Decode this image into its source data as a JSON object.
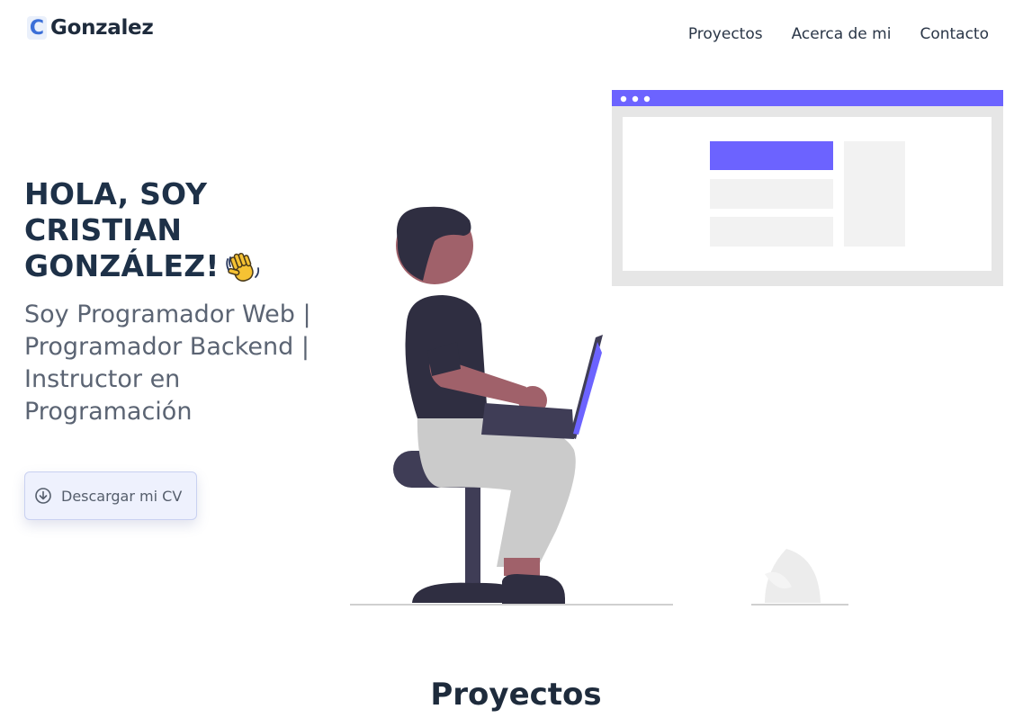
{
  "header": {
    "logo_mark": "C",
    "logo_text": "Gonzalez",
    "nav": [
      {
        "label": "Proyectos"
      },
      {
        "label": "Acerca de mi"
      },
      {
        "label": "Contacto"
      }
    ]
  },
  "hero": {
    "title_lines": [
      "HOLA, SOY",
      "CRISTIAN",
      "GONZÁLEZ!"
    ],
    "subtitle": "Soy Programador Web | Programador Backend | Instructor en Programación",
    "cv_button_label": "Descargar mi CV",
    "cv_button_icon": "download-circle-icon",
    "wave_icon": "waving-hand-icon"
  },
  "illustration": {
    "subject": "person-with-laptop-on-stool",
    "accent_color": "#6c63ff",
    "skin_color": "#a0616a",
    "hair_color": "#2f2e41",
    "panel_color": "#e6e6e6"
  },
  "projects_section": {
    "title": "Proyectos"
  },
  "colors": {
    "heading": "#1e3148",
    "subtitle": "#5b6473",
    "logo_accent": "#3b6fd8",
    "button_bg": "#eef1fd"
  }
}
